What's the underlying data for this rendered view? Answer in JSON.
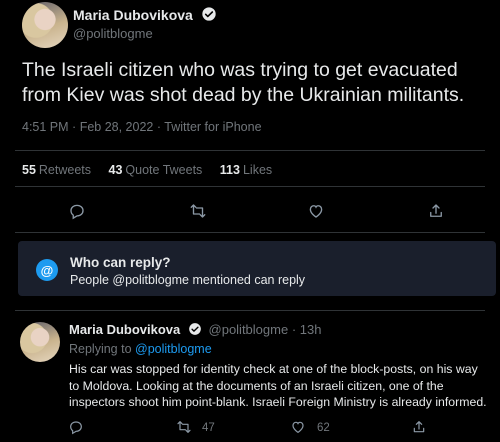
{
  "main_tweet": {
    "author_name": "Maria Dubovikova",
    "handle": "@politblogme",
    "text": "The Israeli citizen who was trying to get evacuated from Kiev was shot dead by the Ukrainian militants.",
    "time": "4:51 PM",
    "date": "Feb 28, 2022",
    "source": "Twitter for iPhone",
    "retweets_count": "55",
    "retweets_label": "Retweets",
    "quote_count": "43",
    "quote_label": "Quote Tweets",
    "likes_count": "113",
    "likes_label": "Likes"
  },
  "reply_restriction": {
    "title": "Who can reply?",
    "subtitle": "People @politblogme mentioned can reply",
    "icon": "at-icon"
  },
  "reply_tweet": {
    "author_name": "Maria Dubovikova",
    "handle": "@politblogme",
    "time": "13h",
    "replying_prefix": "Replying to",
    "replying_to": "@politblogme",
    "text": "His car was stopped for identity check at one of the block-posts, on his way to Moldova. Looking at the documents of an Israeli citizen, one of the inspectors shoot him point-blank. Israeli Foreign Ministry is already informed.",
    "retweet_count": "47",
    "like_count": "62"
  },
  "colors": {
    "background": "#000000",
    "accent": "#1d9bf0",
    "muted": "#71767b",
    "text": "#e7e9ea"
  }
}
